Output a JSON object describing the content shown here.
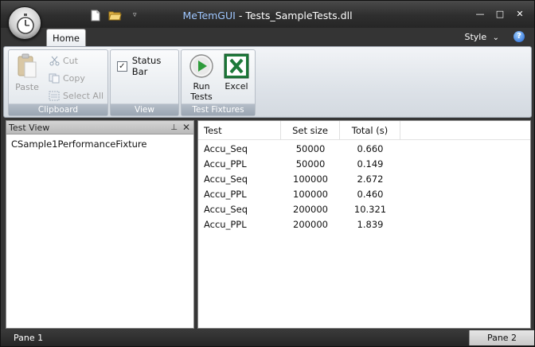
{
  "window": {
    "app_name": "MeTemGUI",
    "title_separator": " - ",
    "document_name": "Tests_SampleTests.dll",
    "controls": {
      "minimize": "—",
      "maximize": "□",
      "close": "✕"
    }
  },
  "quick_access": {
    "more": "▿"
  },
  "tabs": {
    "home": "Home"
  },
  "style_menu": {
    "label": "Style",
    "chevron": "⌄"
  },
  "help": {
    "label": "?"
  },
  "ribbon": {
    "clipboard": {
      "label": "Clipboard",
      "paste": "Paste",
      "cut": "Cut",
      "copy": "Copy",
      "select_all": "Select All"
    },
    "view": {
      "label": "View",
      "status_bar": "Status Bar",
      "status_bar_checked": "✓"
    },
    "test_fixtures": {
      "label": "Test Fixtures",
      "run_tests_line1": "Run",
      "run_tests_line2": "Tests",
      "excel": "Excel"
    }
  },
  "test_view": {
    "title": "Test View",
    "pin": "⊥",
    "close": "✕",
    "items": [
      "CSample1PerformanceFixture"
    ]
  },
  "results": {
    "columns": [
      "Test",
      "Set size",
      "Total (s)"
    ],
    "rows": [
      [
        "Accu_Seq",
        "50000",
        "0.660"
      ],
      [
        "Accu_PPL",
        "50000",
        "0.149"
      ],
      [
        "Accu_Seq",
        "100000",
        "2.672"
      ],
      [
        "Accu_PPL",
        "100000",
        "0.460"
      ],
      [
        "Accu_Seq",
        "200000",
        "10.321"
      ],
      [
        "Accu_PPL",
        "200000",
        "1.839"
      ]
    ]
  },
  "status_bar": {
    "pane1": "Pane 1",
    "pane2": "Pane 2"
  },
  "colors": {
    "title_app_name": "#9fc7ff",
    "excel_green": "#1d7a3a",
    "run_green": "#2e9b3a"
  }
}
